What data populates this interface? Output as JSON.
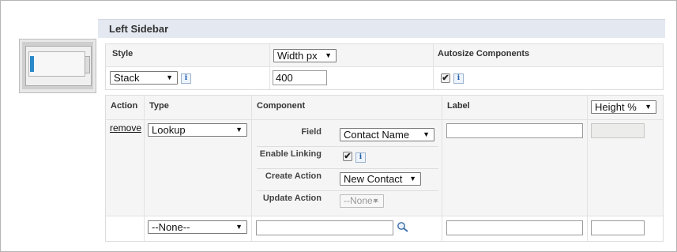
{
  "section": {
    "title": "Left Sidebar"
  },
  "layout_settings": {
    "style_header": "Style",
    "style_value": "Stack",
    "width_unit_value": "Width px",
    "width_value": "400",
    "autosize_header": "Autosize Components",
    "autosize_checked": true,
    "info_glyph": "i"
  },
  "components_table": {
    "headers": {
      "action": "Action",
      "type": "Type",
      "component": "Component",
      "label": "Label",
      "height_unit": "Height %"
    },
    "rows": [
      {
        "action": "remove",
        "type": "Lookup",
        "fields": {
          "field_label": "Field",
          "field_value": "Contact Name",
          "enable_linking_label": "Enable Linking",
          "enable_linking_checked": true,
          "create_action_label": "Create Action",
          "create_action_value": "New Contact",
          "update_action_label": "Update Action",
          "update_action_value": "--None--"
        },
        "label_value": "",
        "height_value": ""
      }
    ],
    "new_row": {
      "type": "--None--",
      "component_value": "",
      "label_value": "",
      "height_value": ""
    }
  },
  "icons": {
    "arrow": "▼",
    "check": "✔"
  },
  "colors": {
    "section_header_bg": "#e3e8f1",
    "panel_bg": "#f5f5f5",
    "accent": "#2b89c9"
  }
}
